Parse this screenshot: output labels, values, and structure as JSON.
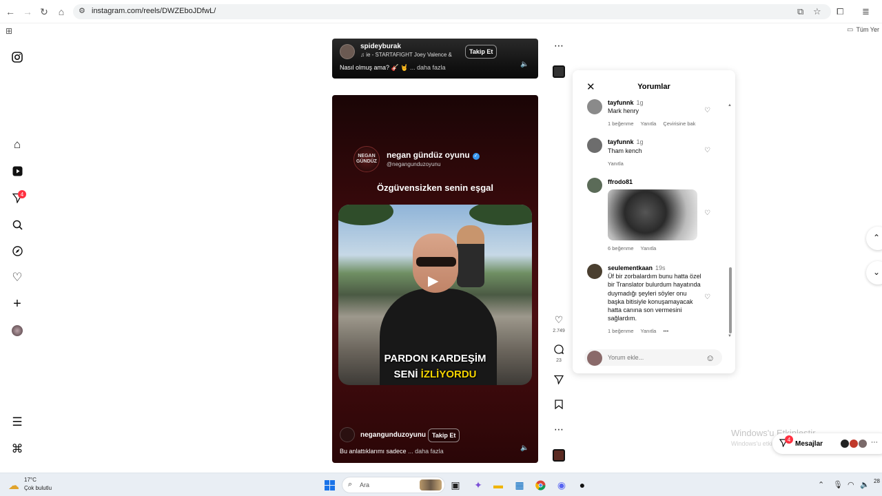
{
  "browser": {
    "url": "instagram.com/reels/DWZEboJDfwL/",
    "bookmark_folder": "Tüm Yer"
  },
  "instagram": {
    "notifications_badge": "4"
  },
  "reel_top": {
    "username": "spideyburak",
    "audio": "♫ ie - STARTAFIGHT  Joey Valence &",
    "follow_label": "Takip Et",
    "caption": "Nasıl olmuş ama? 🎸 🤘",
    "more_label": "... daha fazla"
  },
  "reel_main": {
    "logo_text": "NEGAN GÜNDÜZ",
    "brand_name": "negan gündüz oyunu",
    "brand_handle": "@negangunduzoyunu",
    "headline": "Özgüvensizken senin eşgal",
    "overlay_line1": "PARDON KARDEŞİM",
    "overlay_line2a": "SENİ ",
    "overlay_line2b": "İZLİYORDU",
    "username": "negangunduzoyunu",
    "follow_label": "Takip Et",
    "caption": "Bu anlattıklarımı sadece",
    "more_label": "... daha fazla"
  },
  "actions": {
    "likes": "2.749",
    "comments": "23"
  },
  "comments_panel": {
    "title": "Yorumlar",
    "items": [
      {
        "user": "tayfunnk",
        "time": "1g",
        "text": "Mark henry",
        "likes": "1 beğenme",
        "reply": "Yanıtla",
        "translate": "Çevirisine bak"
      },
      {
        "user": "tayfunnk",
        "time": "1g",
        "text": "Tham kench",
        "reply": "Yanıtla"
      },
      {
        "user": "ffrodo81",
        "likes": "6 beğenme",
        "reply": "Yanıtla"
      },
      {
        "user": "seulementkaan",
        "time": "19s",
        "text": "Üf bir zorbalardım bunu hatta özel bir Translator bulurdum hayatında duymadığı şeyleri söyler onu başka bitisiyle konuşamayacak hatta canına son vermesini sağlardım.",
        "likes": "1 beğenme",
        "reply": "Yanıtla"
      }
    ],
    "input_placeholder": "Yorum ekle..."
  },
  "overlay": {
    "watermark_title": "Windows'u Etkinleştir",
    "watermark_sub": "Windows'u etkinleştirmek için Ayarlar'a gidin.",
    "messages_label": "Mesajlar",
    "messages_badge": "4"
  },
  "taskbar": {
    "temperature": "17°C",
    "weather": "Çok bulutlu",
    "search_placeholder": "Ara",
    "clock": "28"
  }
}
